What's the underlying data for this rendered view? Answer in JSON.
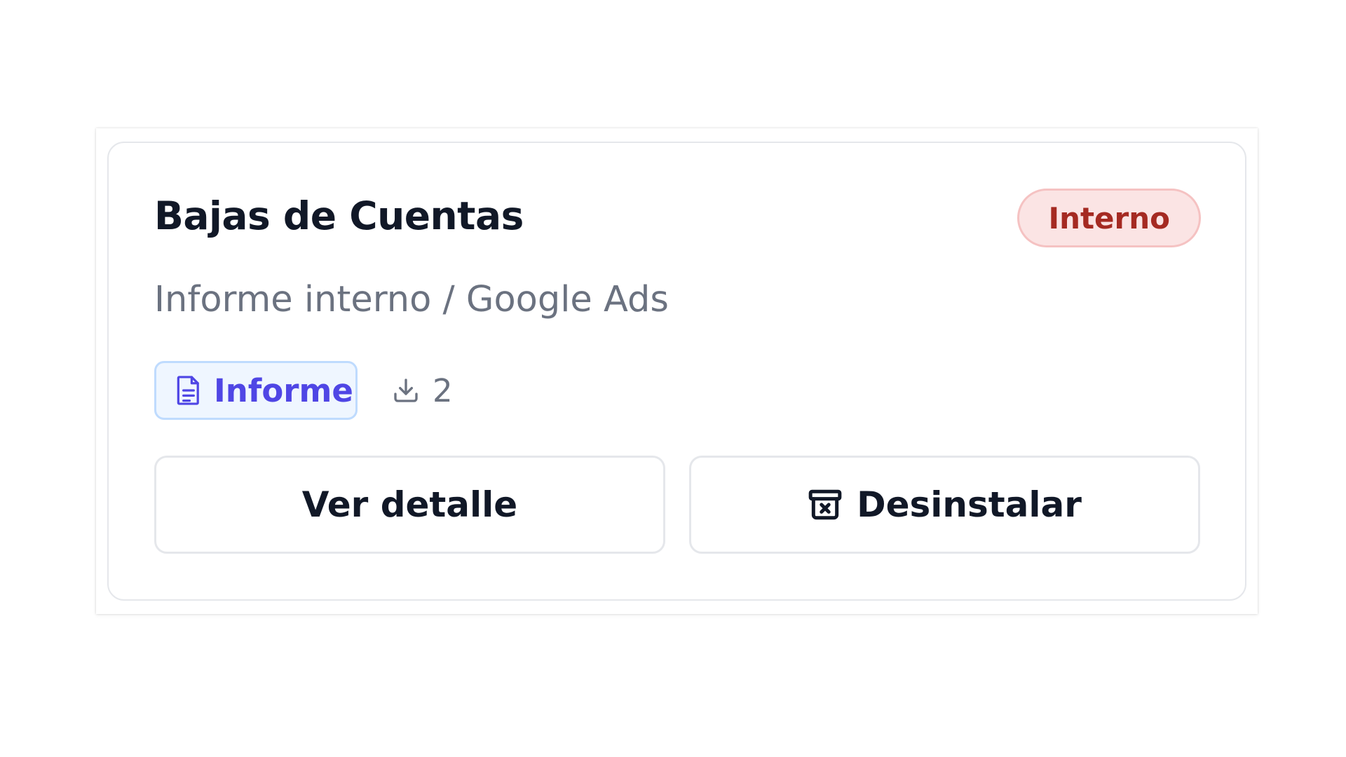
{
  "card": {
    "title": "Bajas de Cuentas",
    "badge": "Interno",
    "subtitle": "Informe interno / Google Ads",
    "type_label": "Informe",
    "type_icon": "document-icon",
    "downloads_icon": "download-icon",
    "downloads_count": "2",
    "detail_button": "Ver detalle",
    "uninstall_button": "Desinstalar",
    "uninstall_icon": "archive-x-icon"
  },
  "colors": {
    "badge_bg": "#fbe4e4",
    "badge_text": "#a52a22",
    "chip_bg": "#eff6ff",
    "chip_text": "#4f46e5",
    "muted_text": "#6b7280"
  }
}
